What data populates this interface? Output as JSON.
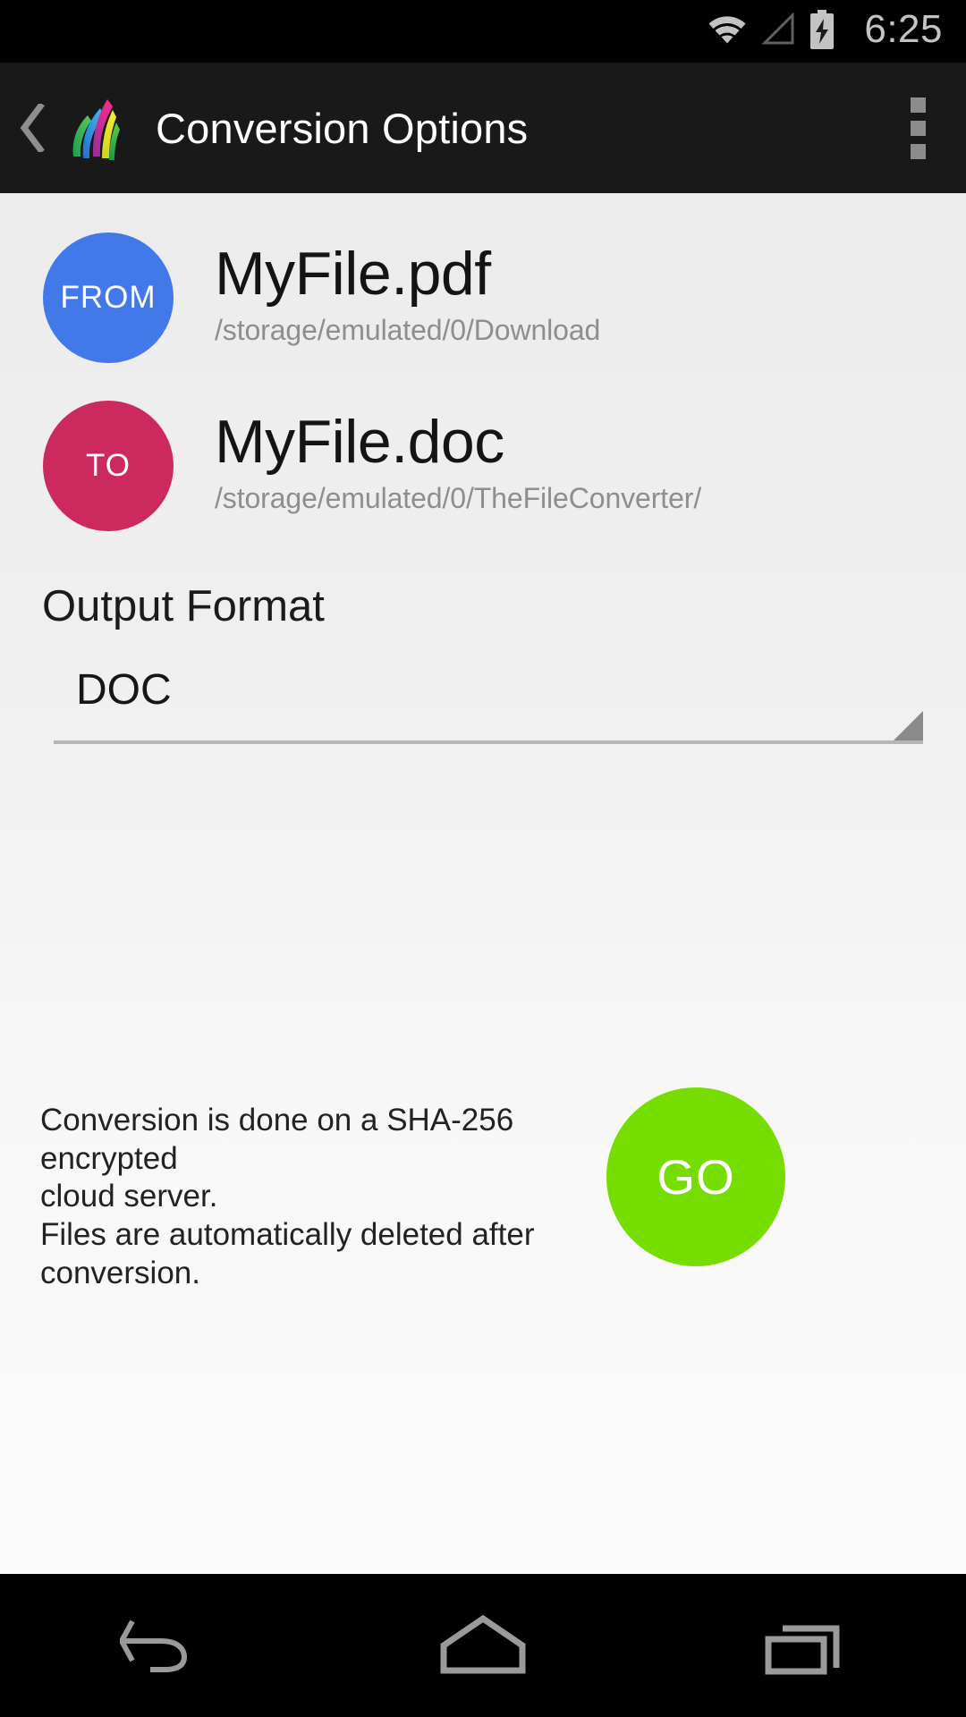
{
  "statusbar": {
    "time": "6:25",
    "wifi_icon": "wifi-icon",
    "signal_icon": "signal-no-service-icon",
    "battery_icon": "battery-charging-icon"
  },
  "appbar": {
    "back_icon": "back-chevron-icon",
    "logo_icon": "app-logo-icon",
    "title": "Conversion Options",
    "overflow_icon": "overflow-menu-icon"
  },
  "conversion": {
    "from": {
      "badge": "FROM",
      "badge_color": "#4179e8",
      "filename": "MyFile.pdf",
      "path": "/storage/emulated/0/Download"
    },
    "to": {
      "badge": "TO",
      "badge_color": "#cc2a5f",
      "filename": "MyFile.doc",
      "path": "/storage/emulated/0/TheFileConverter/"
    }
  },
  "output_format": {
    "label": "Output Format",
    "selected": "DOC",
    "dropdown_icon": "dropdown-triangle-icon"
  },
  "footer": {
    "note_line1": "Conversion is done on a SHA-256 encrypted",
    "note_line2": "cloud server.",
    "note_line3": "Files are automatically deleted after",
    "note_line4": "conversion.",
    "go_label": "GO",
    "go_color": "#76dd00"
  },
  "navbar": {
    "back": "nav-back-icon",
    "home": "nav-home-icon",
    "recents": "nav-recents-icon"
  }
}
